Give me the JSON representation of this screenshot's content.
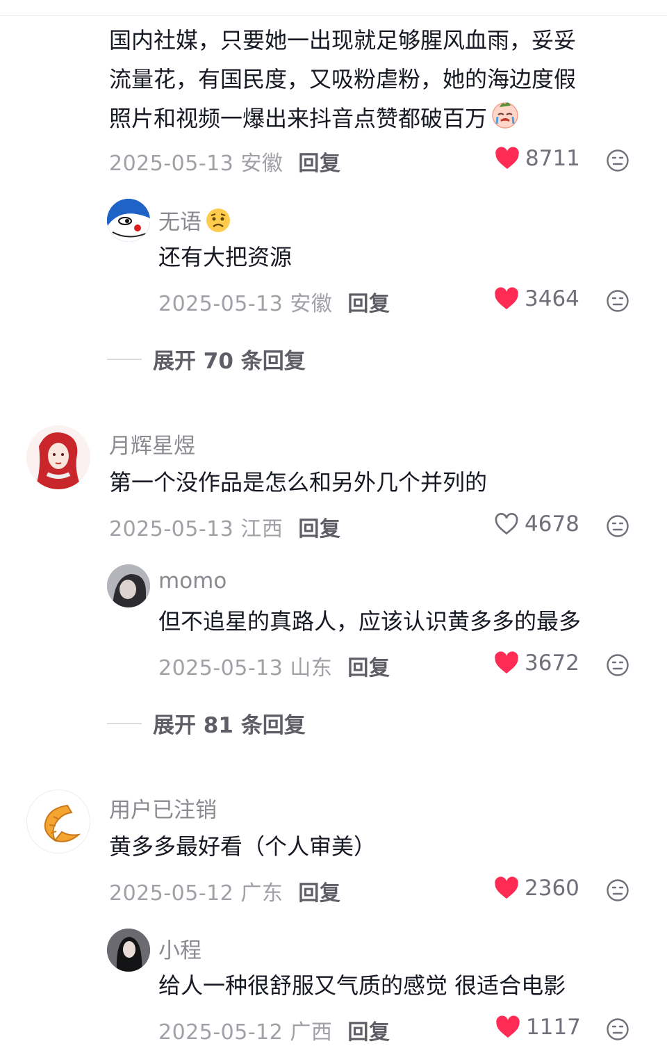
{
  "colors": {
    "like_active": "#fe2c55",
    "text": "#161823",
    "meta": "#a0a1a7"
  },
  "reply_label": "回复",
  "comments": [
    {
      "lines": [
        "国内社媒，只要她一出现就足够腥风血雨，妥妥",
        "流量花，有国民度，又吸粉虐粉，她的海边度假",
        "照片和视频一爆出来抖音点赞都破百万"
      ],
      "date": "2025-05-13",
      "region": "安徽",
      "likes": "8711",
      "liked": true,
      "reply": {
        "name": "无语",
        "text": "还有大把资源",
        "date": "2025-05-13",
        "region": "安徽",
        "likes": "3464",
        "liked": true
      },
      "expand": "展开 70 条回复"
    },
    {
      "name": "月辉星煜",
      "text": "第一个没作品是怎么和另外几个并列的",
      "date": "2025-05-13",
      "region": "江西",
      "likes": "4678",
      "liked": false,
      "reply": {
        "name": "momo",
        "text": "但不追星的真路人，应该认识黄多多的最多",
        "date": "2025-05-13",
        "region": "山东",
        "likes": "3672",
        "liked": true
      },
      "expand": "展开 81 条回复"
    },
    {
      "name": "用户已注销",
      "text": "黄多多最好看（个人审美）",
      "date": "2025-05-12",
      "region": "广东",
      "likes": "2360",
      "liked": true,
      "reply": {
        "name": "小程",
        "text": "给人一种很舒服又气质的感觉 很适合电影",
        "date": "2025-05-12",
        "region": "广西",
        "likes": "1117",
        "liked": true
      }
    }
  ]
}
